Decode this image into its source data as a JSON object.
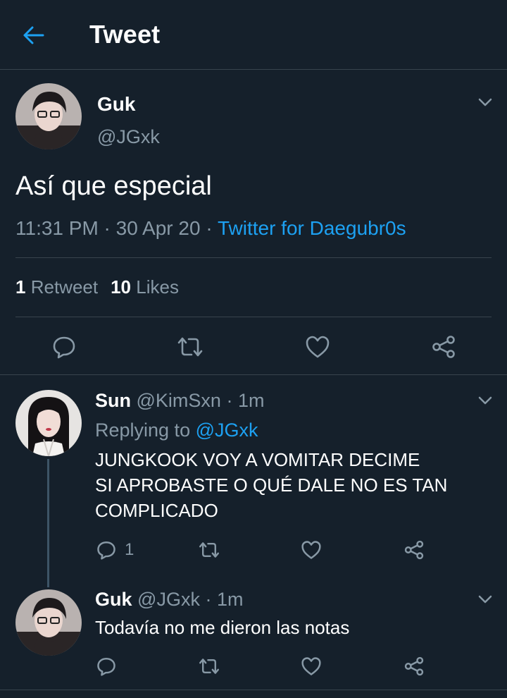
{
  "header": {
    "title": "Tweet",
    "back_icon": "arrow-left-icon",
    "accent": "#1da1f2"
  },
  "main_tweet": {
    "name": "Guk",
    "handle": "@JGxk",
    "text": "Así que especial",
    "time": "11:31 PM",
    "date": "30 Apr 20",
    "separator": " · ",
    "source": "Twitter for Daegubr0s",
    "retweets_count": "1",
    "retweets_label": "Retweet",
    "likes_count": "10",
    "likes_label": "Likes",
    "actions": [
      "reply-icon",
      "retweet-icon",
      "like-icon",
      "share-icon"
    ]
  },
  "replies": [
    {
      "name": "Sun",
      "handle": "@KimSxn",
      "time": "· 1m",
      "replying_prefix": "Replying to",
      "replying_to": "@JGxk",
      "text_lines": [
        "JUNGKOOK VOY A VOMITAR DECIME",
        "SI APROBASTE O QUÉ DALE NO ES TAN",
        "COMPLICADO"
      ],
      "reply_count": "1"
    },
    {
      "name": "Guk",
      "handle": "@JGxk",
      "time": "· 1m",
      "text_lines": [
        "Todavía no me dieron las notas"
      ],
      "reply_count": ""
    }
  ],
  "colors": {
    "background": "#15202b",
    "border": "#38444d",
    "muted_text": "#8899a6",
    "link": "#1da1f2"
  }
}
